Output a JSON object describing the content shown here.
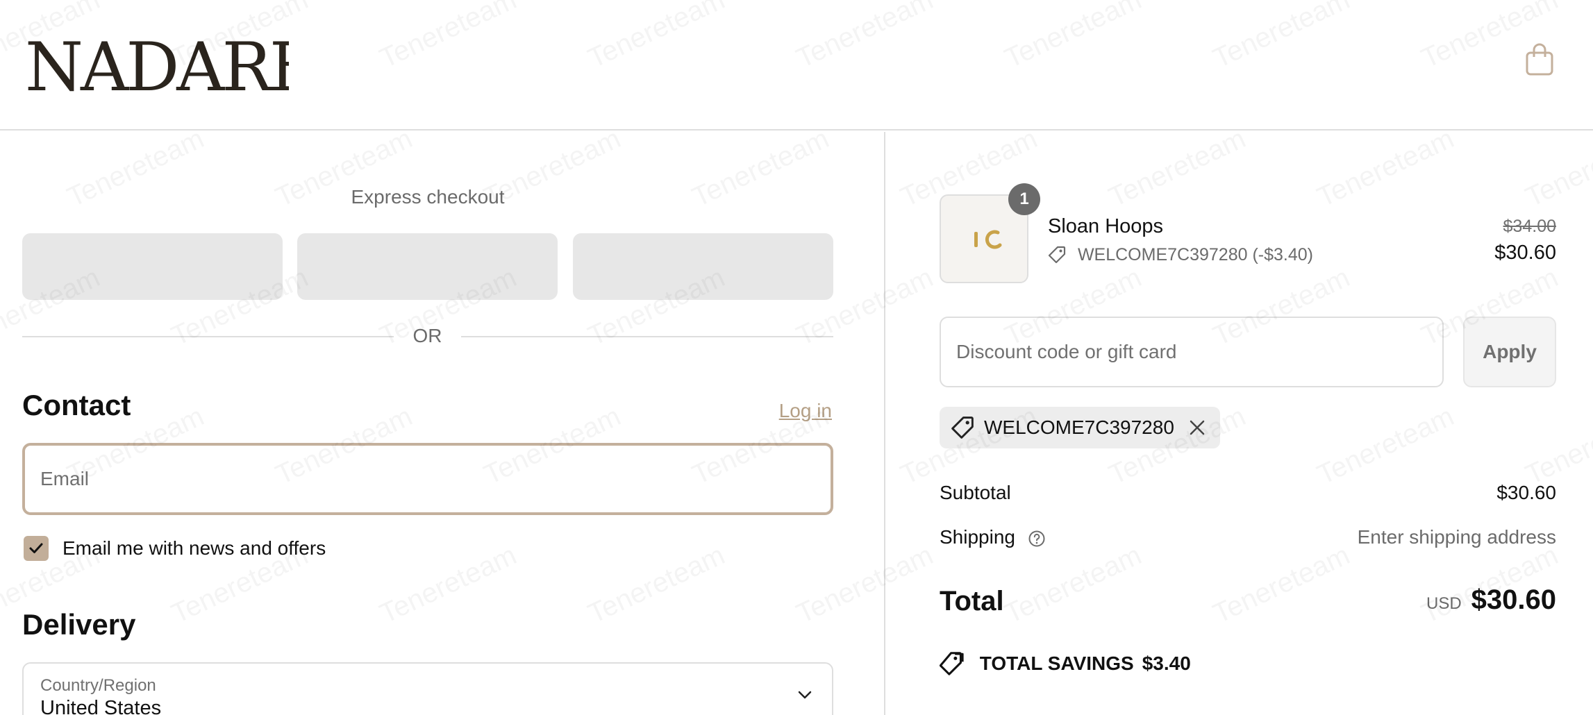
{
  "header": {
    "logo_text": "NADARÉ",
    "cart_icon": "shopping-bag-icon"
  },
  "express": {
    "title": "Express checkout",
    "or_label": "OR"
  },
  "contact": {
    "title": "Contact",
    "login_label": "Log in",
    "email_placeholder": "Email",
    "newsletter_label": "Email me with news and offers",
    "newsletter_checked": true
  },
  "delivery": {
    "title": "Delivery",
    "country_label": "Country/Region",
    "country_value": "United States"
  },
  "order": {
    "item": {
      "quantity": "1",
      "name": "Sloan Hoops",
      "discount_text": "WELCOME7C397280 (-$3.40)",
      "original_price": "$34.00",
      "price": "$30.60"
    },
    "discount_placeholder": "Discount code or gift card",
    "apply_label": "Apply",
    "applied_code": "WELCOME7C397280",
    "subtotal_label": "Subtotal",
    "subtotal_value": "$30.60",
    "shipping_label": "Shipping",
    "shipping_value": "Enter shipping address",
    "total_label": "Total",
    "total_currency": "USD",
    "total_value": "$30.60",
    "savings_label": "TOTAL SAVINGS",
    "savings_value": "$3.40"
  },
  "watermark": "Tenereteam",
  "colors": {
    "accent": "#c4b09c",
    "link": "#b49f85",
    "logo": "#2a241d",
    "badge": "#6b6b6b"
  }
}
